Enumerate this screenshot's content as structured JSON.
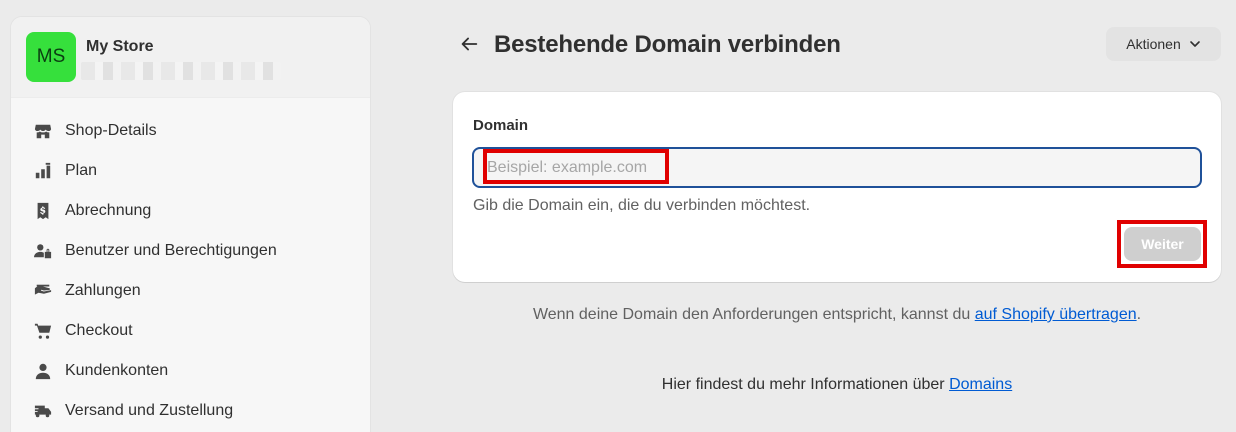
{
  "store": {
    "avatar_initials": "MS",
    "name": "My Store"
  },
  "sidebar": {
    "items": [
      {
        "label": "Shop-Details",
        "icon": "store-icon"
      },
      {
        "label": "Plan",
        "icon": "plan-icon"
      },
      {
        "label": "Abrechnung",
        "icon": "billing-icon"
      },
      {
        "label": "Benutzer und Berechtigungen",
        "icon": "users-icon"
      },
      {
        "label": "Zahlungen",
        "icon": "payments-icon"
      },
      {
        "label": "Checkout",
        "icon": "cart-icon"
      },
      {
        "label": "Kundenkonten",
        "icon": "person-icon"
      },
      {
        "label": "Versand und Zustellung",
        "icon": "truck-icon"
      }
    ]
  },
  "header": {
    "title": "Bestehende Domain verbinden",
    "actions_label": "Aktionen"
  },
  "form": {
    "label": "Domain",
    "value": "",
    "placeholder": "Beispiel: example.com",
    "help": "Gib die Domain ein, die du verbinden möchtest.",
    "submit_label": "Weiter"
  },
  "info": {
    "transfer_text": "Wenn deine Domain den Anforderungen entspricht, kannst du ",
    "transfer_link": "auf Shopify übertragen",
    "transfer_suffix": ".",
    "more_text": "Hier findest du mehr Informationen über ",
    "more_link": "Domains"
  },
  "colors": {
    "avatar_bg": "#36e03c",
    "input_focus": "#1f5199",
    "highlight": "#e00000",
    "link": "#005bd3",
    "disabled_button": "#cfcfcf"
  }
}
